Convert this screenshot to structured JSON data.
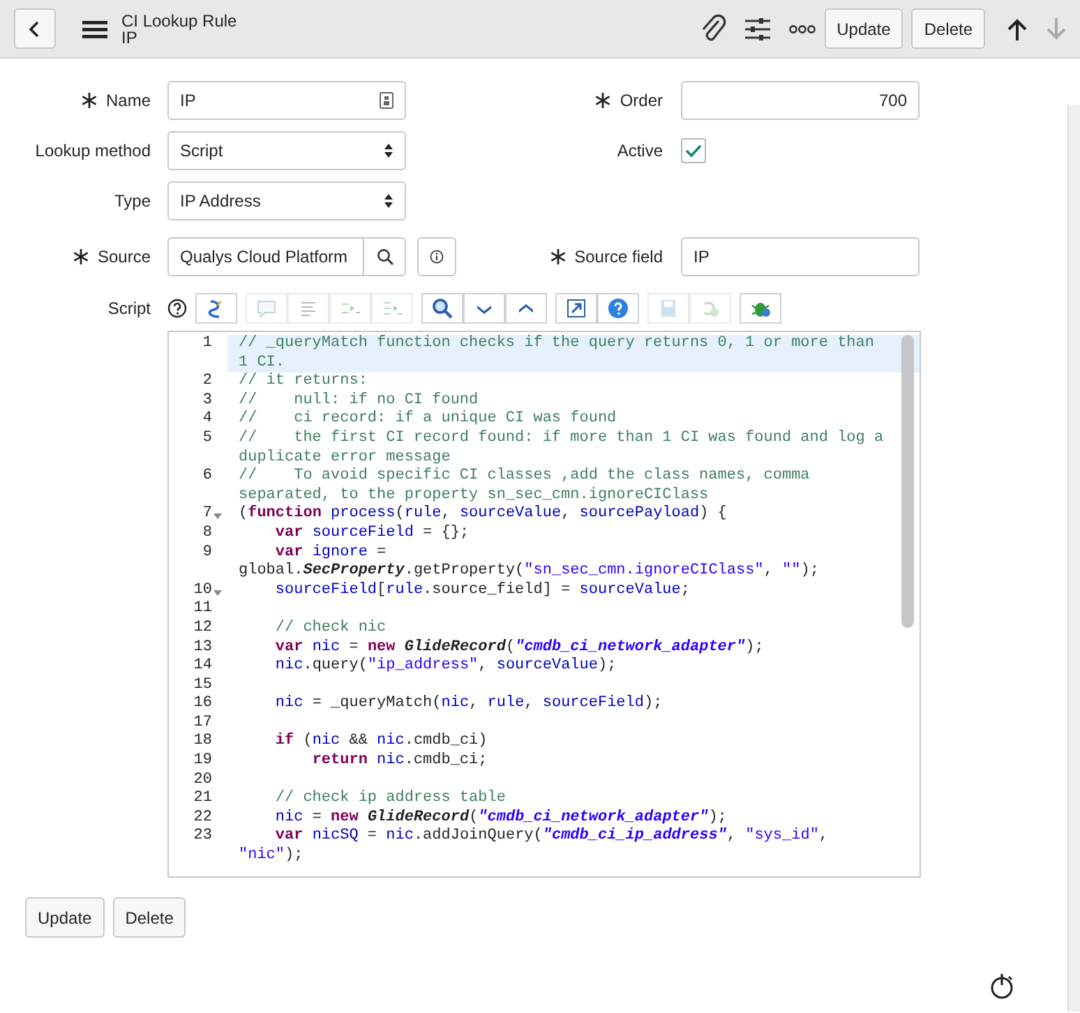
{
  "header": {
    "title": "CI Lookup Rule",
    "subtitle": "IP",
    "buttons": [
      "Update",
      "Delete"
    ],
    "nav": [
      {
        "kind": "up",
        "disabled": false
      },
      {
        "kind": "down",
        "disabled": true
      }
    ]
  },
  "rows": [
    {
      "left": {
        "label": "Name",
        "required": true,
        "kind": "text",
        "value": "IP"
      },
      "right": {
        "label": "Order",
        "required": true,
        "kind": "number",
        "value": "700"
      }
    },
    {
      "left": {
        "label": "Lookup method",
        "required": false,
        "kind": "select",
        "value": "Script"
      },
      "right": {
        "label": "Active",
        "required": false,
        "kind": "checkbox",
        "checked": true
      }
    },
    {
      "left": {
        "label": "Type",
        "required": false,
        "kind": "select",
        "value": "IP Address"
      }
    },
    {
      "left": {
        "label": "Source",
        "required": true,
        "kind": "reference",
        "value": "Qualys Cloud Platform"
      },
      "right": {
        "label": "Source field",
        "required": true,
        "kind": "text-plain",
        "value": "IP"
      }
    }
  ],
  "script": {
    "label": "Script",
    "toolbar": [
      [
        {
          "kind": "format",
          "disabled": false
        }
      ],
      [
        {
          "kind": "comment",
          "disabled": true
        },
        {
          "kind": "format-code",
          "disabled": true
        },
        {
          "kind": "replace",
          "disabled": true
        },
        {
          "kind": "replace-all",
          "disabled": true
        }
      ],
      [
        {
          "kind": "search",
          "disabled": false
        },
        {
          "kind": "next",
          "disabled": false
        },
        {
          "kind": "previous",
          "disabled": false
        }
      ],
      [
        {
          "kind": "fullscreen",
          "disabled": false
        },
        {
          "kind": "help",
          "disabled": false
        }
      ],
      [
        {
          "kind": "save",
          "disabled": true
        },
        {
          "kind": "debug",
          "disabled": true
        }
      ],
      [
        {
          "kind": "debugger",
          "disabled": false
        }
      ]
    ],
    "lines": [
      {
        "number": "1",
        "fold": false,
        "highlighted": true,
        "tokens": [
          {
            "kind": "comment",
            "text": "// _queryMatch function checks if the query returns 0, 1 or more than 1 CI."
          }
        ]
      },
      {
        "number": "2",
        "fold": false,
        "highlighted": false,
        "tokens": [
          {
            "kind": "comment",
            "text": "// it returns:"
          }
        ]
      },
      {
        "number": "3",
        "fold": false,
        "highlighted": false,
        "tokens": [
          {
            "kind": "comment",
            "text": "//    null: if no CI found"
          }
        ]
      },
      {
        "number": "4",
        "fold": false,
        "highlighted": false,
        "tokens": [
          {
            "kind": "comment",
            "text": "//    ci record: if a unique CI was found"
          }
        ]
      },
      {
        "number": "5",
        "fold": false,
        "highlighted": false,
        "tokens": [
          {
            "kind": "comment",
            "text": "//    the first CI record found: if more than 1 CI was found and log a duplicate error message"
          }
        ]
      },
      {
        "number": "6",
        "fold": false,
        "highlighted": false,
        "tokens": [
          {
            "kind": "comment",
            "text": "//    To avoid specific CI classes ,add the class names, comma separated, to the property sn_sec_cmn.ignoreCIClass"
          }
        ]
      },
      {
        "number": "7",
        "fold": true,
        "highlighted": false,
        "tokens": [
          {
            "kind": "plain",
            "text": "("
          },
          {
            "kind": "keyword",
            "text": "function"
          },
          {
            "kind": "variable",
            "text": " process"
          },
          {
            "kind": "plain",
            "text": "("
          },
          {
            "kind": "variable",
            "text": "rule"
          },
          {
            "kind": "plain",
            "text": ", "
          },
          {
            "kind": "variable",
            "text": "sourceValue"
          },
          {
            "kind": "plain",
            "text": ", "
          },
          {
            "kind": "variable",
            "text": "sourcePayload"
          },
          {
            "kind": "plain",
            "text": ") {"
          }
        ]
      },
      {
        "number": "8",
        "fold": false,
        "highlighted": false,
        "tokens": [
          {
            "kind": "keyword",
            "text": "    var"
          },
          {
            "kind": "variable",
            "text": " sourceField"
          },
          {
            "kind": "plain",
            "text": " = {};"
          }
        ]
      },
      {
        "number": "9",
        "fold": false,
        "highlighted": false,
        "tokens": [
          {
            "kind": "keyword",
            "text": "    var"
          },
          {
            "kind": "variable",
            "text": " ignore"
          },
          {
            "kind": "plain",
            "text": " = global."
          },
          {
            "kind": "type",
            "text": "SecProperty"
          },
          {
            "kind": "plain",
            "text": ".getProperty("
          },
          {
            "kind": "string",
            "text": "\"sn_sec_cmn.ignoreCIClass\""
          },
          {
            "kind": "plain",
            "text": ", "
          },
          {
            "kind": "string",
            "text": "\"\""
          },
          {
            "kind": "plain",
            "text": ");"
          }
        ]
      },
      {
        "number": "10",
        "fold": true,
        "highlighted": false,
        "tokens": [
          {
            "kind": "variable",
            "text": "    sourceField"
          },
          {
            "kind": "plain",
            "text": "["
          },
          {
            "kind": "variable",
            "text": "rule"
          },
          {
            "kind": "plain",
            "text": ".source_field] = "
          },
          {
            "kind": "variable",
            "text": "sourceValue"
          },
          {
            "kind": "plain",
            "text": ";"
          }
        ]
      },
      {
        "number": "11",
        "fold": false,
        "highlighted": false
      },
      {
        "number": "12",
        "fold": false,
        "highlighted": false,
        "tokens": [
          {
            "kind": "comment",
            "text": "    // check nic"
          }
        ]
      },
      {
        "number": "13",
        "fold": false,
        "highlighted": false,
        "tokens": [
          {
            "kind": "keyword",
            "text": "    var"
          },
          {
            "kind": "variable",
            "text": " nic"
          },
          {
            "kind": "plain",
            "text": " = "
          },
          {
            "kind": "keyword",
            "text": "new"
          },
          {
            "kind": "type",
            "text": " GlideRecord"
          },
          {
            "kind": "plain",
            "text": "("
          },
          {
            "kind": "string-em",
            "text": "\"cmdb_ci_network_adapter\""
          },
          {
            "kind": "plain",
            "text": ");"
          }
        ]
      },
      {
        "number": "14",
        "fold": false,
        "highlighted": false,
        "tokens": [
          {
            "kind": "variable",
            "text": "    nic"
          },
          {
            "kind": "plain",
            "text": ".query("
          },
          {
            "kind": "string",
            "text": "\"ip_address\""
          },
          {
            "kind": "plain",
            "text": ", "
          },
          {
            "kind": "variable",
            "text": "sourceValue"
          },
          {
            "kind": "plain",
            "text": ");"
          }
        ]
      },
      {
        "number": "15",
        "fold": false,
        "highlighted": false
      },
      {
        "number": "16",
        "fold": false,
        "highlighted": false,
        "tokens": [
          {
            "kind": "variable",
            "text": "    nic"
          },
          {
            "kind": "plain",
            "text": " = _queryMatch("
          },
          {
            "kind": "variable",
            "text": "nic"
          },
          {
            "kind": "plain",
            "text": ", "
          },
          {
            "kind": "variable",
            "text": "rule"
          },
          {
            "kind": "plain",
            "text": ", "
          },
          {
            "kind": "variable",
            "text": "sourceField"
          },
          {
            "kind": "plain",
            "text": ");"
          }
        ]
      },
      {
        "number": "17",
        "fold": false,
        "highlighted": false
      },
      {
        "number": "18",
        "fold": false,
        "highlighted": false,
        "tokens": [
          {
            "kind": "keyword",
            "text": "    if"
          },
          {
            "kind": "plain",
            "text": " ("
          },
          {
            "kind": "variable",
            "text": "nic"
          },
          {
            "kind": "plain",
            "text": " && "
          },
          {
            "kind": "variable",
            "text": "nic"
          },
          {
            "kind": "plain",
            "text": ".cmdb_ci)"
          }
        ]
      },
      {
        "number": "19",
        "fold": false,
        "highlighted": false,
        "tokens": [
          {
            "kind": "keyword",
            "text": "        return"
          },
          {
            "kind": "variable",
            "text": " nic"
          },
          {
            "kind": "plain",
            "text": ".cmdb_ci;"
          }
        ]
      },
      {
        "number": "20",
        "fold": false,
        "highlighted": false
      },
      {
        "number": "21",
        "fold": false,
        "highlighted": false,
        "tokens": [
          {
            "kind": "comment",
            "text": "    // check ip address table"
          }
        ]
      },
      {
        "number": "22",
        "fold": false,
        "highlighted": false,
        "tokens": [
          {
            "kind": "variable",
            "text": "    nic"
          },
          {
            "kind": "plain",
            "text": " = "
          },
          {
            "kind": "keyword",
            "text": "new"
          },
          {
            "kind": "type",
            "text": " GlideRecord"
          },
          {
            "kind": "plain",
            "text": "("
          },
          {
            "kind": "string-em",
            "text": "\"cmdb_ci_network_adapter\""
          },
          {
            "kind": "plain",
            "text": ");"
          }
        ]
      },
      {
        "number": "23",
        "fold": false,
        "highlighted": false,
        "tokens": [
          {
            "kind": "keyword",
            "text": "    var"
          },
          {
            "kind": "variable",
            "text": " nicSQ"
          },
          {
            "kind": "plain",
            "text": " = "
          },
          {
            "kind": "variable",
            "text": "nic"
          },
          {
            "kind": "plain",
            "text": ".addJoinQuery("
          },
          {
            "kind": "string-em",
            "text": "\"cmdb_ci_ip_address\""
          },
          {
            "kind": "plain",
            "text": ", "
          },
          {
            "kind": "string",
            "text": "\"sys_id\""
          },
          {
            "kind": "plain",
            "text": ", "
          },
          {
            "kind": "string",
            "text": "\"nic\""
          },
          {
            "kind": "plain",
            "text": ");"
          }
        ]
      }
    ]
  },
  "footer_buttons": [
    "Update",
    "Delete"
  ]
}
